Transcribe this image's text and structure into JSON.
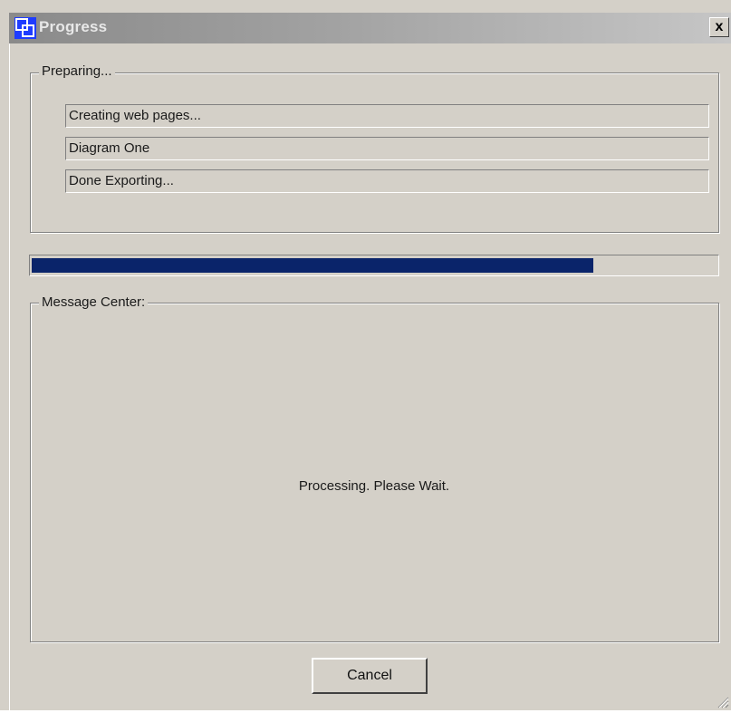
{
  "window": {
    "title": "Progress",
    "close_glyph": "x",
    "icon": "app-logo-icon"
  },
  "preparing_group": {
    "label": "Preparing...",
    "fields": [
      "Creating web pages...",
      "Diagram One",
      "Done Exporting..."
    ]
  },
  "progress": {
    "value_percent": 82,
    "fill_color": "#0a246a"
  },
  "message_center": {
    "label": "Message Center:",
    "message": "Processing. Please Wait."
  },
  "buttons": {
    "cancel_label": "Cancel"
  },
  "colors": {
    "dialog_bg": "#d4d0c8",
    "progress_fill": "#0a246a"
  }
}
